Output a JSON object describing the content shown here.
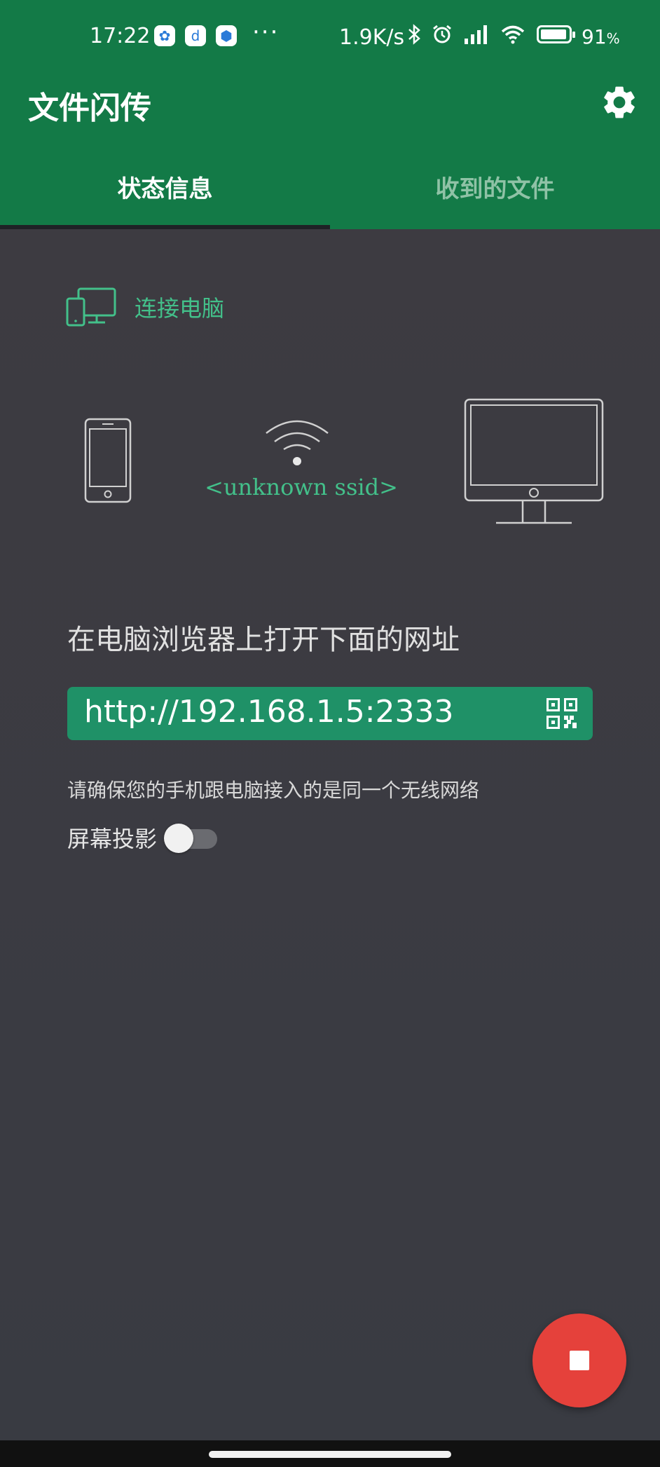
{
  "status_bar": {
    "time": "17:22",
    "more": "···",
    "network_speed": "1.9K/s",
    "battery": "91",
    "battery_unit": "%",
    "battery_level": 0.91
  },
  "app": {
    "title": "文件闪传",
    "accent_color": "#137a47"
  },
  "tabs": [
    {
      "label": "状态信息",
      "active": true
    },
    {
      "label": "收到的文件",
      "active": false
    }
  ],
  "connect": {
    "label": "连接电脑",
    "ssid": "<unknown ssid>"
  },
  "instruction": "在电脑浏览器上打开下面的网址",
  "url": "http://192.168.1.5:2333",
  "note": "请确保您的手机跟电脑接入的是同一个无线网络",
  "screen_cast": {
    "label": "屏幕投影",
    "enabled": false
  },
  "icons": {
    "settings": "gear-icon",
    "qr": "qr-code-icon",
    "devices": "devices-icon",
    "phone": "phone-icon",
    "wifi": "wifi-icon",
    "monitor": "monitor-icon",
    "fab": "stop-icon"
  },
  "fab_color": "#e5413b"
}
